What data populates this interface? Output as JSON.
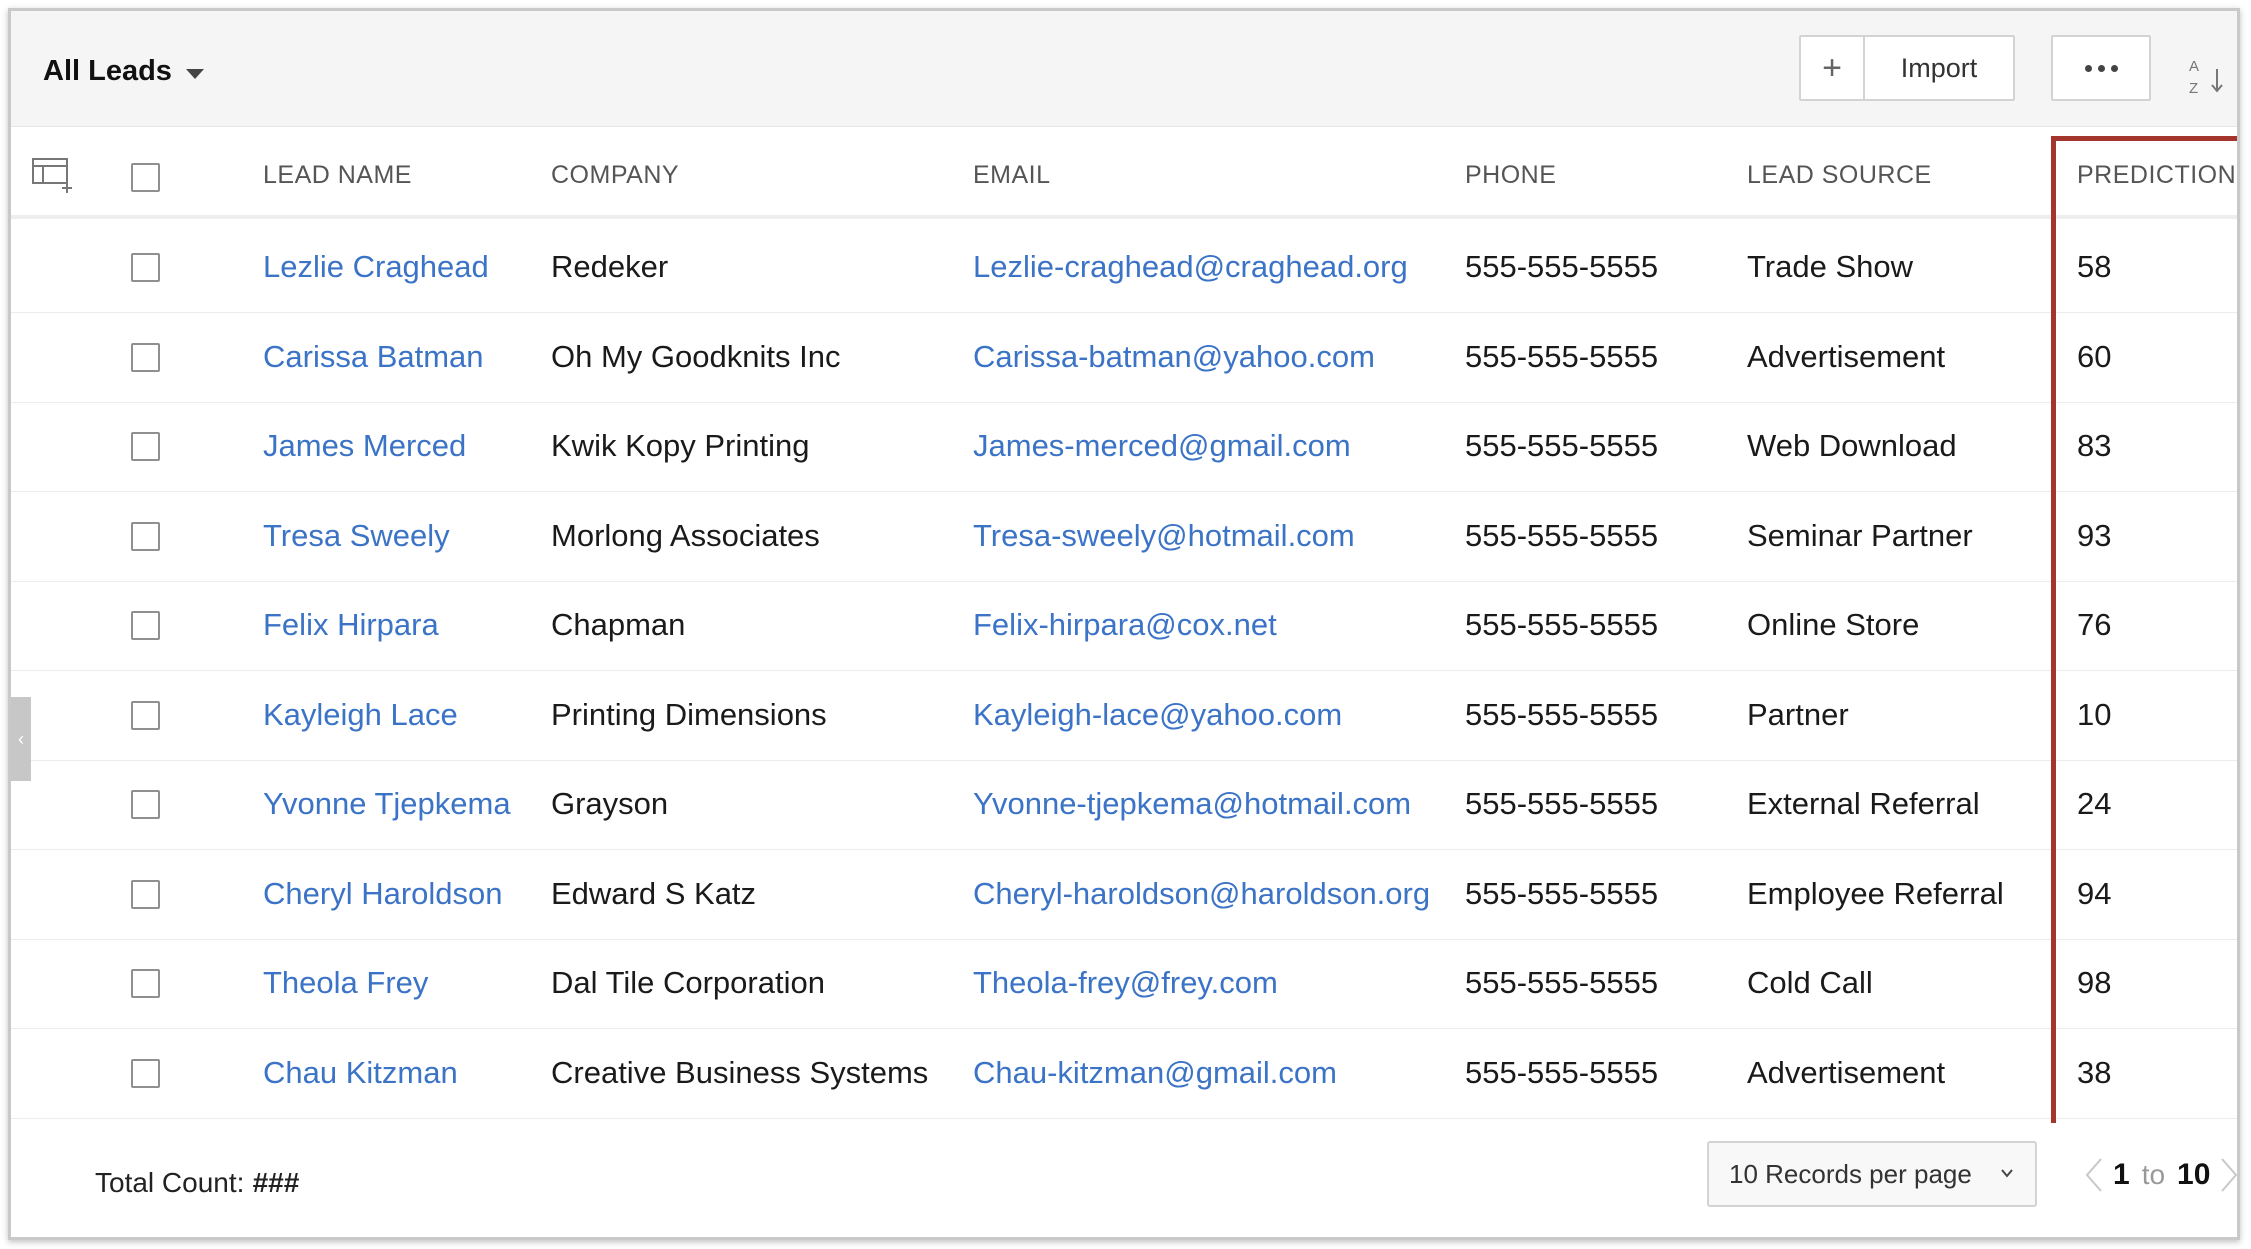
{
  "toolbar": {
    "view_title": "All Leads",
    "import_label": "Import",
    "plus_label": "+"
  },
  "table": {
    "headers": {
      "lead_name": "LEAD NAME",
      "company": "COMPANY",
      "email": "EMAIL",
      "phone": "PHONE",
      "lead_source": "LEAD SOURCE",
      "prediction": "PREDICTION"
    },
    "rows": [
      {
        "name": "Lezlie Craghead",
        "company": "Redeker",
        "email": "Lezlie-craghead@craghead.org",
        "phone": "555-555-5555",
        "source": "Trade Show",
        "prediction": "58"
      },
      {
        "name": "Carissa Batman",
        "company": "Oh My Goodknits Inc",
        "email": "Carissa-batman@yahoo.com",
        "phone": "555-555-5555",
        "source": "Advertisement",
        "prediction": "60"
      },
      {
        "name": "James Merced",
        "company": "Kwik Kopy Printing",
        "email": "James-merced@gmail.com",
        "phone": "555-555-5555",
        "source": "Web Download",
        "prediction": "83"
      },
      {
        "name": "Tresa Sweely",
        "company": "Morlong Associates",
        "email": "Tresa-sweely@hotmail.com",
        "phone": "555-555-5555",
        "source": "Seminar Partner",
        "prediction": "93"
      },
      {
        "name": "Felix Hirpara",
        "company": "Chapman",
        "email": "Felix-hirpara@cox.net",
        "phone": "555-555-5555",
        "source": "Online Store",
        "prediction": "76"
      },
      {
        "name": "Kayleigh Lace",
        "company": "Printing Dimensions",
        "email": "Kayleigh-lace@yahoo.com",
        "phone": "555-555-5555",
        "source": "Partner",
        "prediction": "10"
      },
      {
        "name": "Yvonne Tjepkema",
        "company": "Grayson",
        "email": "Yvonne-tjepkema@hotmail.com",
        "phone": "555-555-5555",
        "source": "External Referral",
        "prediction": "24"
      },
      {
        "name": "Cheryl Haroldson",
        "company": "Edward S Katz",
        "email": "Cheryl-haroldson@haroldson.org",
        "phone": "555-555-5555",
        "source": "Employee Referral",
        "prediction": "94"
      },
      {
        "name": "Theola Frey",
        "company": "Dal Tile Corporation",
        "email": "Theola-frey@frey.com",
        "phone": "555-555-5555",
        "source": "Cold Call",
        "prediction": "98"
      },
      {
        "name": "Chau Kitzman",
        "company": "Creative Business Systems",
        "email": "Chau-kitzman@gmail.com",
        "phone": "555-555-5555",
        "source": "Advertisement",
        "prediction": "38"
      }
    ]
  },
  "footer": {
    "total_label": "Total Count: ",
    "total_value": "###",
    "per_page": "10 Records per page",
    "page_from": "1",
    "page_to_label": "to",
    "page_to": "10"
  },
  "colors": {
    "link": "#3b73c6",
    "highlight": "#a3352c",
    "toolbar_bg": "#f5f5f5"
  },
  "icons": {
    "view_dropdown": "caret-down-icon",
    "table_settings": "table-settings-icon",
    "more": "more-dots-icon",
    "sort": "sort-az-icon",
    "collapse": "chevron-left-icon",
    "pager_prev": "chevron-left-icon",
    "pager_next": "chevron-right-icon"
  }
}
